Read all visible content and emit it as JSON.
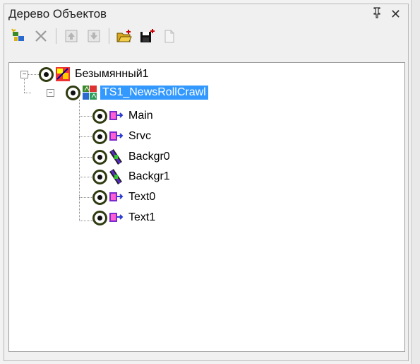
{
  "panel": {
    "title": "Дерево Объектов",
    "pin_glyph": "ᵖ",
    "close_glyph": "✕"
  },
  "toolbar": {
    "buttons": [
      {
        "name": "add-object-button",
        "icon": "add-node-icon"
      },
      {
        "name": "delete-button",
        "icon": "delete-x-icon"
      },
      {
        "name": "move-up-button",
        "icon": "arrow-up-icon"
      },
      {
        "name": "move-down-button",
        "icon": "arrow-down-icon"
      },
      {
        "name": "open-button",
        "icon": "open-folder-icon"
      },
      {
        "name": "save-button",
        "icon": "save-disk-icon"
      },
      {
        "name": "new-document-button",
        "icon": "new-document-icon"
      }
    ]
  },
  "tree": {
    "root": {
      "label": "Безымянный1",
      "expander": "−",
      "icon": "project-icon"
    },
    "scene": {
      "label": "TS1_NewsRollCrawl",
      "expander": "−",
      "icon": "scene-icon",
      "selected": true
    },
    "children": [
      {
        "label": "Main",
        "icon": "object-arrow-icon"
      },
      {
        "label": "Srvc",
        "icon": "object-arrow-icon"
      },
      {
        "label": "Backgr0",
        "icon": "film-icon"
      },
      {
        "label": "Backgr1",
        "icon": "film-icon"
      },
      {
        "label": "Text0",
        "icon": "object-arrow-icon"
      },
      {
        "label": "Text1",
        "icon": "object-arrow-icon"
      }
    ]
  },
  "colors": {
    "selection": "#3399ff",
    "eye_ring": "#2e3a0f"
  }
}
